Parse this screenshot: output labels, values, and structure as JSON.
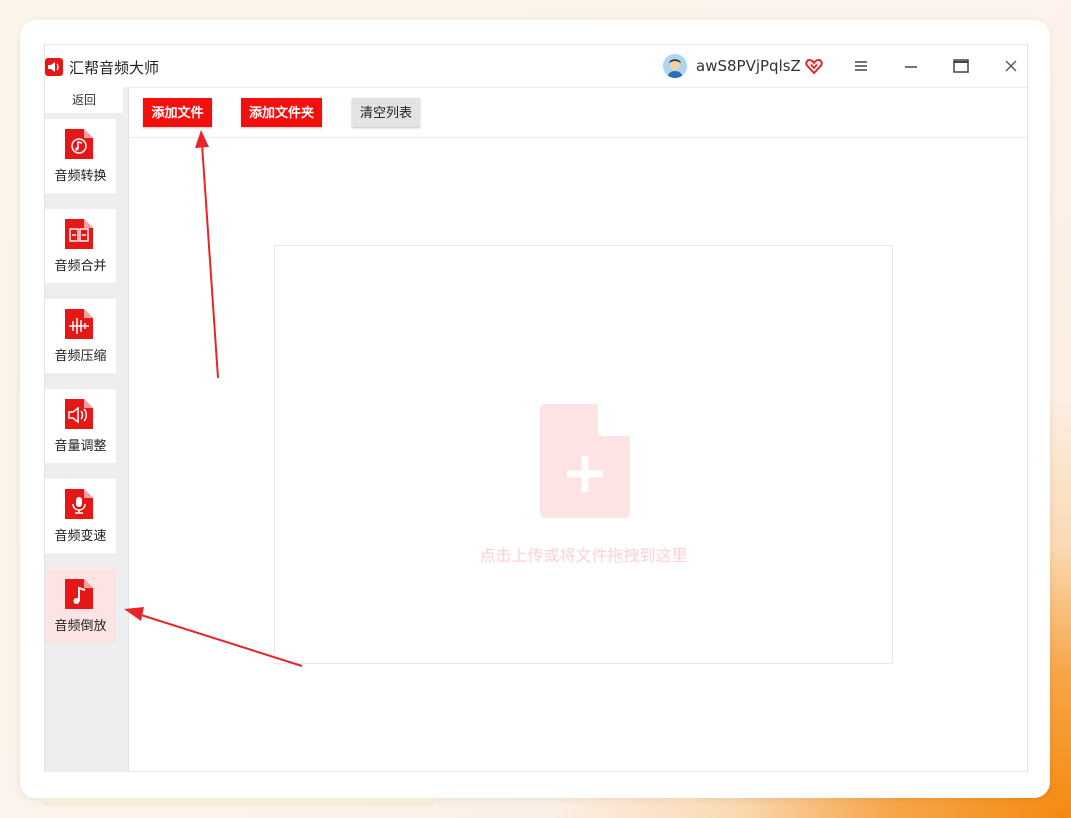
{
  "app": {
    "title": "汇帮音频大师",
    "username": "awS8PVjPqlsZ"
  },
  "sidebar": {
    "back_label": "返回",
    "items": [
      {
        "label": "音频转换",
        "icon": "audio-convert-icon"
      },
      {
        "label": "音频合并",
        "icon": "audio-merge-icon"
      },
      {
        "label": "音频压缩",
        "icon": "audio-compress-icon"
      },
      {
        "label": "音量调整",
        "icon": "volume-adjust-icon"
      },
      {
        "label": "音频变速",
        "icon": "audio-speed-icon"
      },
      {
        "label": "音频倒放",
        "icon": "audio-reverse-icon",
        "active": true
      }
    ]
  },
  "toolbar": {
    "add_file_label": "添加文件",
    "add_folder_label": "添加文件夹",
    "clear_list_label": "清空列表"
  },
  "dropzone": {
    "hint": "点击上传或将文件拖拽到这里",
    "icon": "file-add-icon"
  },
  "colors": {
    "accent": "#f40f0f",
    "active_nav_bg": "#fde4e4",
    "annotation_arrow": "#e8262a"
  }
}
